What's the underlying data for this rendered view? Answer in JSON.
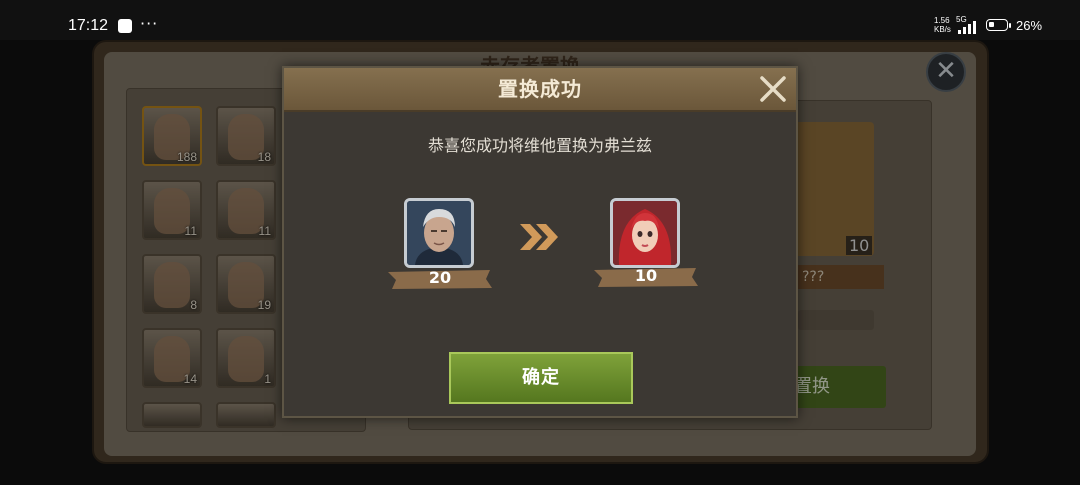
{
  "status_bar": {
    "time": "17:12",
    "more": "···",
    "net_speed": "1.56",
    "net_unit": "KB/s",
    "network": "5G",
    "battery_pct": "26%"
  },
  "background": {
    "title": "赤存考置换",
    "heroes": [
      {
        "count": "188",
        "selected": true
      },
      {
        "count": "18"
      },
      {
        "count": "11"
      },
      {
        "count": "11"
      },
      {
        "count": "8"
      },
      {
        "count": "19"
      },
      {
        "count": "14"
      },
      {
        "count": "1"
      }
    ],
    "card_count": "10",
    "card_name": "???",
    "swap_button": "置换"
  },
  "dialog": {
    "title": "置换成功",
    "message": "恭喜您成功将维他置换为弗兰兹",
    "from": {
      "count": "20"
    },
    "to": {
      "count": "10"
    },
    "confirm": "确定"
  },
  "colors": {
    "header": "#6b573a",
    "confirm_green": "#6a8c2c",
    "ribbon": "#8a6b4a"
  }
}
